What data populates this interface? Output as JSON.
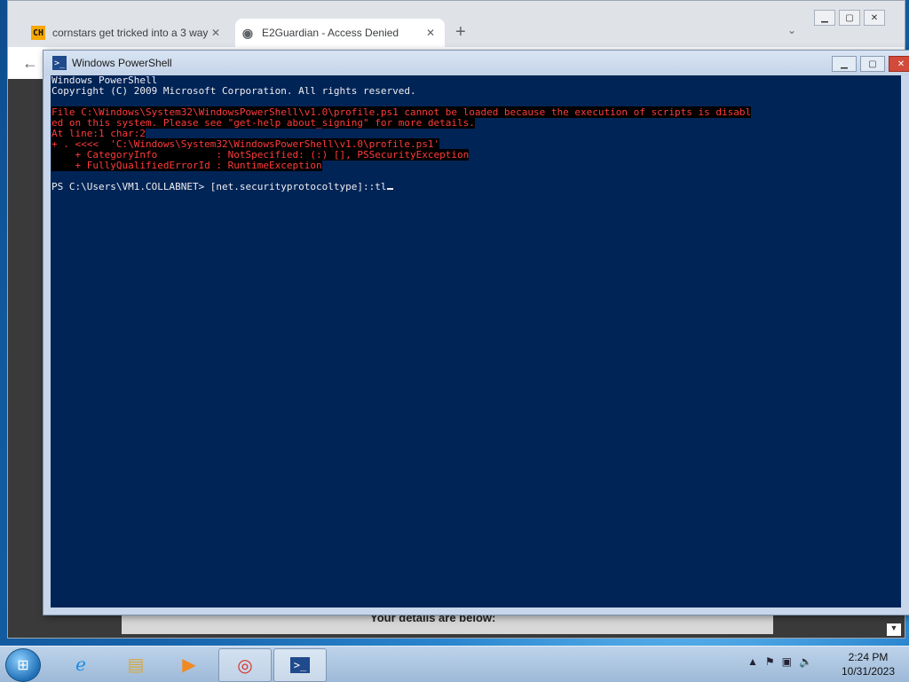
{
  "browser": {
    "tabs": [
      {
        "label": "cornstars get tricked into a 3 way",
        "favicon": "CH",
        "close": "✕"
      },
      {
        "label": "E2Guardian - Access Denied",
        "favicon": "globe-icon",
        "close": "✕"
      }
    ],
    "new_tab": "+",
    "tab_menu": "⌄",
    "back": "←",
    "page_text": "Your details are below:"
  },
  "powershell": {
    "title": "Windows PowerShell",
    "lines": [
      {
        "text": "Windows PowerShell",
        "type": "normal"
      },
      {
        "text": "Copyright (C) 2009 Microsoft Corporation. All rights reserved.",
        "type": "normal"
      },
      {
        "text": "",
        "type": "normal"
      },
      {
        "text": "File C:\\Windows\\System32\\WindowsPowerShell\\v1.0\\profile.ps1 cannot be loaded because the execution of scripts is disabl",
        "type": "error"
      },
      {
        "text": "ed on this system. Please see \"get-help about_signing\" for more details.",
        "type": "error"
      },
      {
        "text": "At line:1 char:2",
        "type": "error"
      },
      {
        "text": "+ . <<<<  'C:\\Windows\\System32\\WindowsPowerShell\\v1.0\\profile.ps1'",
        "type": "error"
      },
      {
        "text": "    + CategoryInfo          : NotSpecified: (:) [], PSSecurityException",
        "type": "error"
      },
      {
        "text": "    + FullyQualifiedErrorId : RuntimeException",
        "type": "error"
      },
      {
        "text": "",
        "type": "normal"
      },
      {
        "text": "PS C:\\Users\\VM1.COLLABNET> [net.securityprotocoltype]::tl",
        "type": "prompt"
      }
    ]
  },
  "taskbar": {
    "clock_time": "2:24 PM",
    "clock_date": "10/31/2023"
  }
}
